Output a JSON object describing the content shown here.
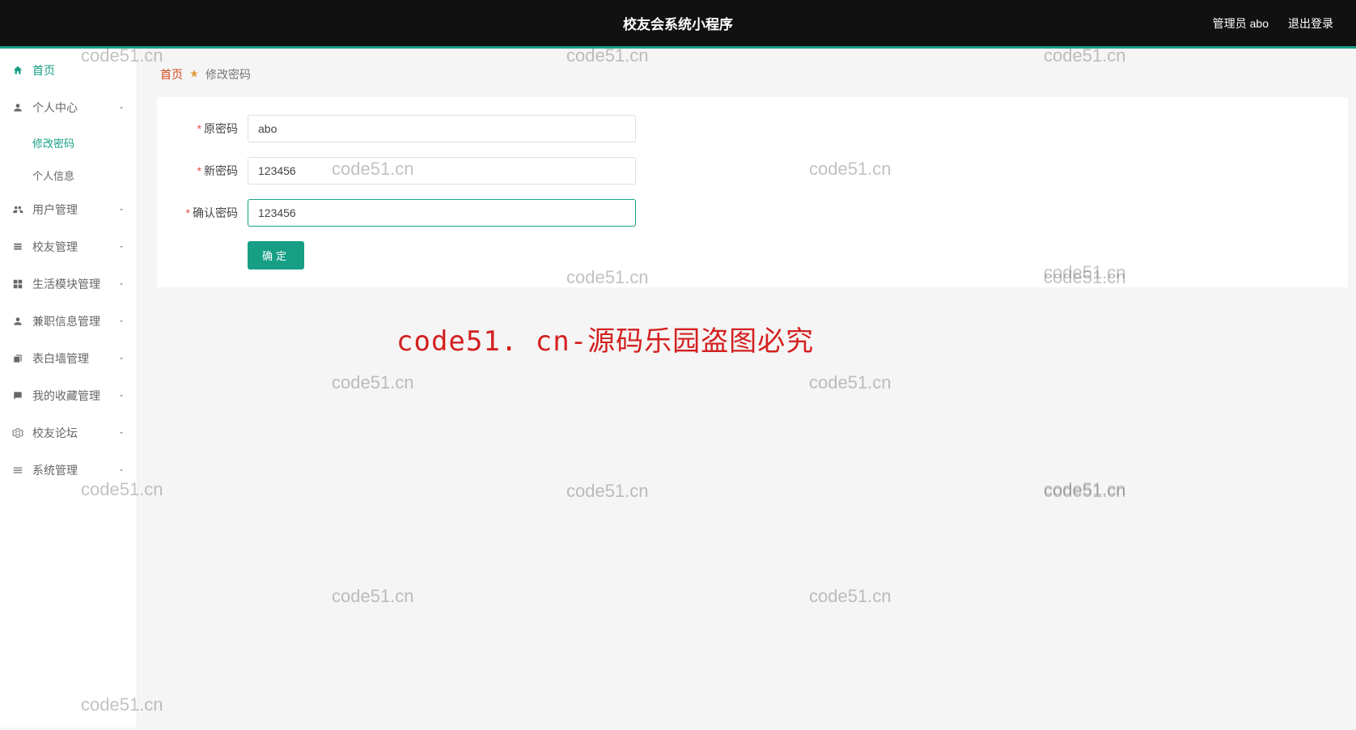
{
  "header": {
    "title": "校友会系统小程序",
    "admin_label": "管理员 abo",
    "logout_label": "退出登录"
  },
  "sidebar": {
    "items": [
      {
        "label": "首页",
        "icon": "home",
        "active": true
      },
      {
        "label": "个人中心",
        "icon": "user",
        "expandable": true,
        "expanded": true,
        "children": [
          {
            "label": "修改密码",
            "active": true
          },
          {
            "label": "个人信息"
          }
        ]
      },
      {
        "label": "用户管理",
        "icon": "users",
        "expandable": true
      },
      {
        "label": "校友管理",
        "icon": "list",
        "expandable": true
      },
      {
        "label": "生活模块管理",
        "icon": "grid",
        "expandable": true
      },
      {
        "label": "兼职信息管理",
        "icon": "user",
        "expandable": true
      },
      {
        "label": "表白墙管理",
        "icon": "copy",
        "expandable": true
      },
      {
        "label": "我的收藏管理",
        "icon": "chat",
        "expandable": true
      },
      {
        "label": "校友论坛",
        "icon": "cog",
        "expandable": true
      },
      {
        "label": "系统管理",
        "icon": "bars",
        "expandable": true
      }
    ]
  },
  "breadcrumb": {
    "home": "首页",
    "current": "修改密码"
  },
  "form": {
    "old_password_label": "原密码",
    "new_password_label": "新密码",
    "confirm_password_label": "确认密码",
    "old_password_value": "abo",
    "new_password_value": "123456",
    "confirm_password_value": "123456",
    "submit_label": "确定"
  },
  "watermark": {
    "small": "code51.cn",
    "big": "code51. cn-源码乐园盗图必究"
  }
}
